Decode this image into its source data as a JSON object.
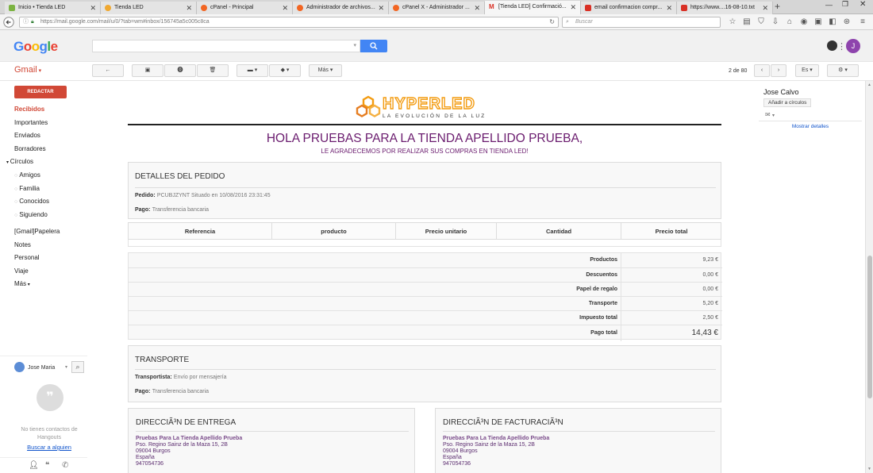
{
  "browser": {
    "tabs": [
      {
        "title": "Inicio • Tienda LED",
        "color": "#7cb342"
      },
      {
        "title": "Tienda LED",
        "color": "#f0a830"
      },
      {
        "title": "cPanel - Principal",
        "color": "#f26522"
      },
      {
        "title": "Administrador de archivos...",
        "color": "#f26522"
      },
      {
        "title": "cPanel X - Administrador ...",
        "color": "#f26522"
      },
      {
        "title": "[Tienda LED] Confirmació...",
        "color": "#d93025"
      },
      {
        "title": "email confirmacion compr...",
        "color": "#d93025"
      },
      {
        "title": "https://www....16-08-10.txt",
        "color": "#d93025"
      }
    ],
    "url": "https://mail.google.com/mail/u/0/?tab=wm#inbox/156745a5c005c8ca",
    "search_placeholder": "Buscar"
  },
  "google": {
    "logo": "Google",
    "apps_icon": "apps-grid-icon",
    "avatar_letter": "J"
  },
  "gmail": {
    "label": "Gmail",
    "toolbar": {
      "more_label": "Más",
      "pagination": "2 de 80",
      "lang": "Es"
    },
    "compose_label": "REDACTAR",
    "folders": [
      "Recibidos",
      "Importantes",
      "Enviados",
      "Borradores"
    ],
    "circles_label": "Círculos",
    "circles": [
      "Amigos",
      "Familia",
      "Conocidos",
      "Siguiendo"
    ],
    "labels": [
      "[Gmail]Papelera",
      "Notes",
      "Personal",
      "Viaje",
      "Más"
    ],
    "hangouts": {
      "user": "Jose Maria",
      "empty_text": "No tienes contactos de Hangouts",
      "search_link": "Buscar a alguien"
    }
  },
  "email": {
    "brand_main": "HYPERLED",
    "brand_tagline": "LA EVOLUCIÓN DE LA LUZ",
    "greeting": "HOLA PRUEBAS PARA LA TIENDA APELLIDO PRUEBA,",
    "thanks": "LE AGRADECEMOS POR REALIZAR SUS COMPRAS EN TIENDA LED!",
    "order": {
      "title": "DETALLES DEL PEDIDO",
      "order_label": "Pedido:",
      "order_value": "PCUBJZYNT Situado en 10/08/2016 23:31:45",
      "payment_label": "Pago:",
      "payment_value": "Transferencia bancaria"
    },
    "table_headers": [
      "Referencia",
      "producto",
      "Precio unitario",
      "Cantidad",
      "Precio total"
    ],
    "totals": [
      {
        "label": "Productos",
        "value": "9,23 €"
      },
      {
        "label": "Descuentos",
        "value": "0,00 €"
      },
      {
        "label": "Papel de regalo",
        "value": "0,00 €"
      },
      {
        "label": "Transporte",
        "value": "5,20 €"
      },
      {
        "label": "Impuesto total",
        "value": "2,50 €"
      }
    ],
    "grand_total": {
      "label": "Pago total",
      "value": "14,43 €"
    },
    "shipping": {
      "title": "TRANSPORTE",
      "carrier_label": "Transportista:",
      "carrier_value": "Envío por mensajería",
      "payment_label": "Pago:",
      "payment_value": "Transferencia bancaria"
    },
    "delivery": {
      "title": "DIRECCIÃ³N DE ENTREGA",
      "name": "Pruebas Para La Tienda Apellido Prueba",
      "street": "Pso. Regino Sainz de la Maza 15, 2B",
      "city": "09004 Burgos",
      "country": "España",
      "phone": "947054736"
    },
    "billing": {
      "title": "DIRECCIÃ³N DE FACTURACIÃ³N",
      "name": "Pruebas Para La Tienda Apellido Prueba",
      "street": "Pso. Regino Sainz de la Maza 15, 2B",
      "city": "09004 Burgos",
      "country": "España",
      "phone": "947054736"
    }
  },
  "contact": {
    "name": "Jose Calvo",
    "add_circles": "Añadir a círculos",
    "show_details": "Mostrar detalles"
  },
  "colors": {
    "brand_purple": "#6a1b6e",
    "compose_red": "#d14836",
    "folder_red": "#d14836",
    "search_blue": "#4285f4",
    "brand_orange": "#f39c12"
  }
}
